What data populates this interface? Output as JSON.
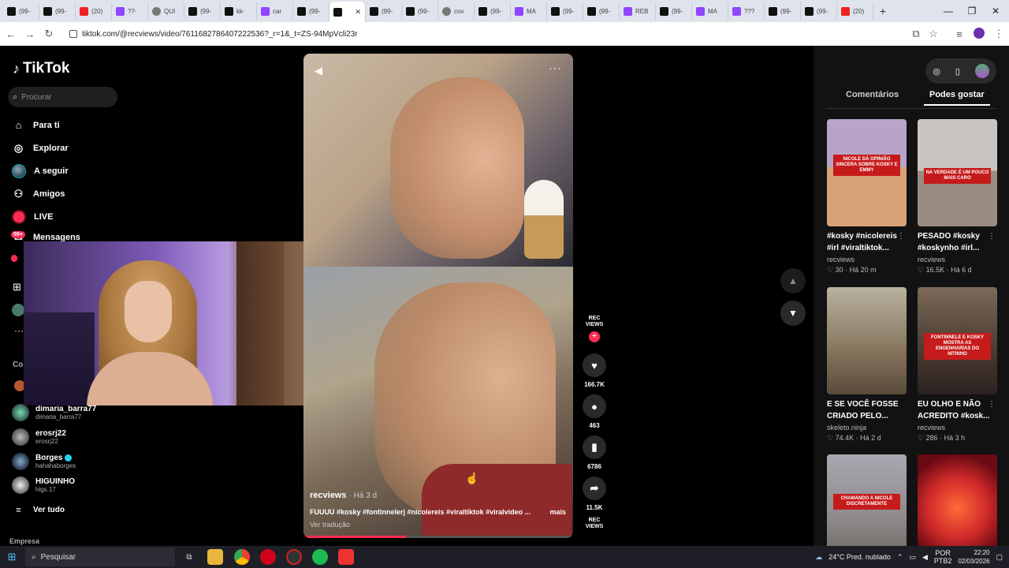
{
  "browser": {
    "tabs": [
      {
        "label": "(99-",
        "icon": "tiktok"
      },
      {
        "label": "(99-",
        "icon": "tiktok"
      },
      {
        "label": "(20)",
        "icon": "youtube"
      },
      {
        "label": "??·",
        "icon": "twitch"
      },
      {
        "label": "QUI",
        "icon": "generic"
      },
      {
        "label": "(99-",
        "icon": "tiktok"
      },
      {
        "label": "kk·",
        "icon": "tiktok"
      },
      {
        "label": "car",
        "icon": "twitch"
      },
      {
        "label": "(99-",
        "icon": "tiktok"
      },
      {
        "label": "",
        "icon": "tiktok",
        "active": true
      },
      {
        "label": "(99-",
        "icon": "tiktok"
      },
      {
        "label": "(99-",
        "icon": "tiktok"
      },
      {
        "label": "cov",
        "icon": "generic"
      },
      {
        "label": "(99-",
        "icon": "tiktok"
      },
      {
        "label": "MA",
        "icon": "twitch"
      },
      {
        "label": "(99-",
        "icon": "tiktok"
      },
      {
        "label": "(99-",
        "icon": "tiktok"
      },
      {
        "label": "REB",
        "icon": "twitch"
      },
      {
        "label": "(99-",
        "icon": "tiktok"
      },
      {
        "label": "MA",
        "icon": "twitch"
      },
      {
        "label": "???",
        "icon": "twitch"
      },
      {
        "label": "(99-",
        "icon": "tiktok"
      },
      {
        "label": "(99-",
        "icon": "tiktok"
      },
      {
        "label": "(20)",
        "icon": "youtube"
      }
    ],
    "url": "tiktok.com/@recviews/video/7611682786407222536?_r=1&_t=ZS-94MpVcli23r"
  },
  "sidebar": {
    "logo": "TikTok",
    "search_placeholder": "Procurar",
    "nav": [
      {
        "label": "Para ti",
        "icon": "home-icon"
      },
      {
        "label": "Explorar",
        "icon": "compass-icon"
      },
      {
        "label": "A seguir",
        "icon": "avatar-icon"
      },
      {
        "label": "Amigos",
        "icon": "friends-icon"
      },
      {
        "label": "LIVE",
        "icon": "live-icon"
      },
      {
        "label": "Mensagens",
        "icon": "messages-icon",
        "badge": "99+"
      }
    ],
    "section_label": "Co",
    "following": [
      {
        "name": "dimaria_barra77",
        "handle": "dimaria_barra77"
      },
      {
        "name": "erosrj22",
        "handle": "erosrj22"
      },
      {
        "name": "Borges",
        "handle": "hahahaborges",
        "verified": true
      },
      {
        "name": "HIGUINHO",
        "handle": "higs.17"
      }
    ],
    "see_all": "Ver tudo",
    "footer": "Empresa"
  },
  "video": {
    "author": "recviews",
    "ago": "· Há 3 d",
    "description": "FUUUU #kosky #fontinnelerj #nicolereis #viraltiktok #viralvideo ...",
    "more": "mais",
    "translate": "Ver tradução",
    "progress": 0.38,
    "creator_badge": "REC VIEWS",
    "likes": "166.7K",
    "comments": "463",
    "saves": "6786",
    "shares": "11.5K"
  },
  "right_panel": {
    "tabs": [
      "Comentários",
      "Podes gostar"
    ],
    "active_tab": "Podes gostar",
    "cards": [
      {
        "title": "#kosky #nicolereis #irl #viraltiktok...",
        "author": "recviews",
        "likes": "30",
        "ago": "Há 20 m",
        "banner": "NICOLE DÁ OPINIÃO SINCERA SOBRE KOSKY E EMMY"
      },
      {
        "title": "PESADO #kosky #koskynho #irl...",
        "author": "recviews",
        "likes": "16.5K",
        "ago": "Há 6 d",
        "banner": "NA VERDADE É UM POUCO MAIS CARO"
      },
      {
        "title": "E SE VOCÊ FOSSE CRIADO PELO...",
        "author": "skeleto.ninja",
        "likes": "74.4K",
        "ago": "Há 2 d",
        "banner": ""
      },
      {
        "title": "EU OLHO E NÃO ACREDITO #kosk...",
        "author": "recviews",
        "likes": "286",
        "ago": "Há 3 h",
        "banner": "FONTINNELE E KOSKY MOSTRA AS ENGENHARIAS DO NITINHO"
      },
      {
        "title": "",
        "author": "",
        "likes": "",
        "ago": "",
        "banner": "CHAMANDO A NICOLE DISCRETAMENTE"
      },
      {
        "title": "",
        "author": "",
        "likes": "",
        "ago": "",
        "banner": ""
      }
    ]
  },
  "taskbar": {
    "search": "Pesquisar",
    "weather": "24°C Pred. nublado",
    "lang": "POR",
    "layout": "PTB2",
    "time": "22:20",
    "date": "02/03/2026"
  }
}
